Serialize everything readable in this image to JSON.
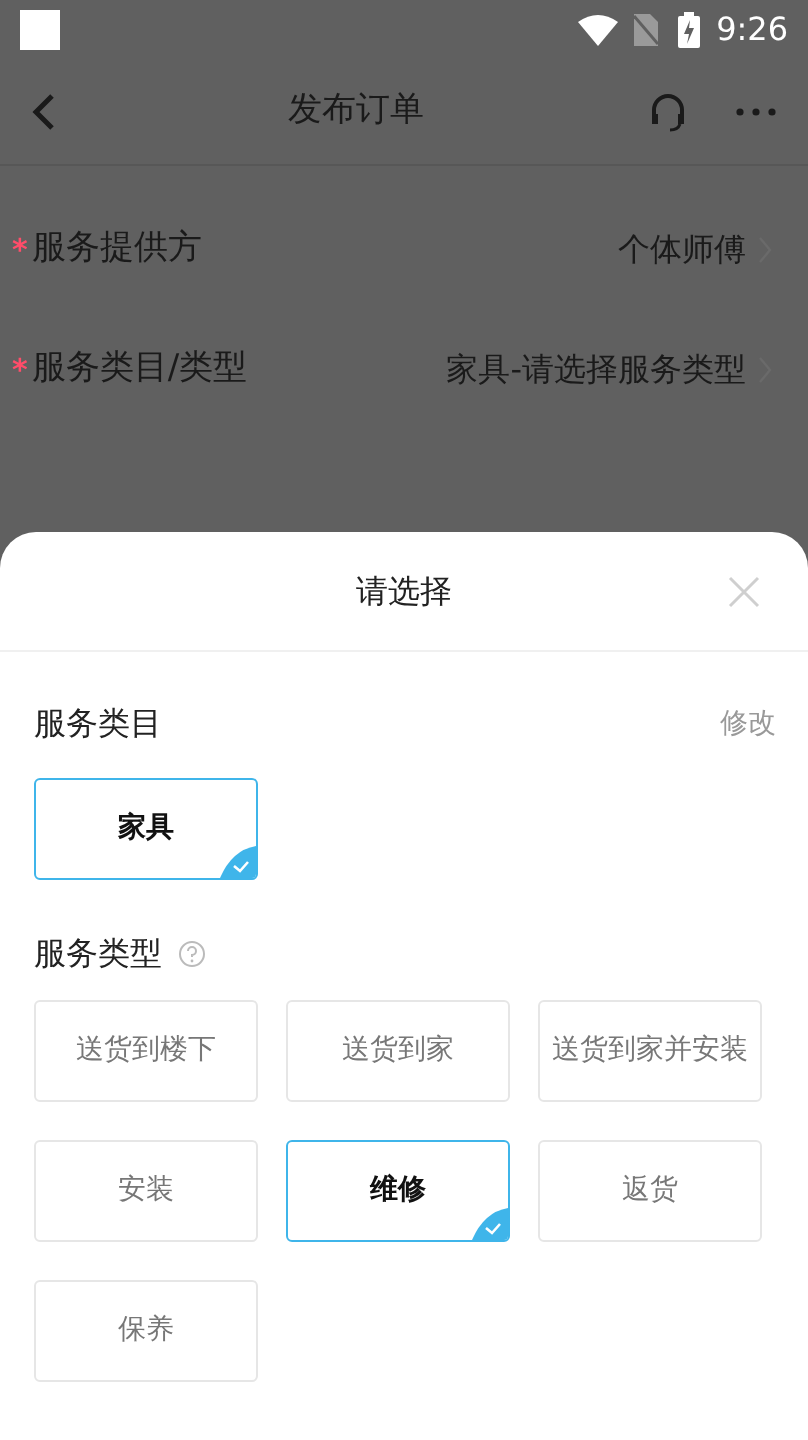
{
  "status_bar": {
    "time": "9:26"
  },
  "header": {
    "title": "发布订单"
  },
  "form_rows": [
    {
      "required_mark": "*",
      "label": "服务提供方",
      "value": "个体师傅"
    },
    {
      "required_mark": "*",
      "label": "服务类目/类型",
      "value": "家具-请选择服务类型"
    }
  ],
  "sheet": {
    "title": "请选择",
    "category_section": {
      "label": "服务类目",
      "action": "修改",
      "options": [
        {
          "label": "家具",
          "selected": true
        }
      ]
    },
    "type_section": {
      "label": "服务类型",
      "options": [
        {
          "label": "送货到楼下",
          "selected": false
        },
        {
          "label": "送货到家",
          "selected": false
        },
        {
          "label": "送货到家并安装",
          "selected": false
        },
        {
          "label": "安装",
          "selected": false
        },
        {
          "label": "维修",
          "selected": true
        },
        {
          "label": "返货",
          "selected": false
        },
        {
          "label": "保养",
          "selected": false
        }
      ]
    }
  }
}
